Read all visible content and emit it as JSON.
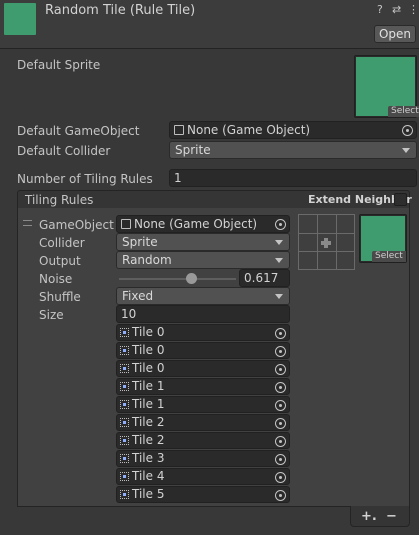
{
  "header": {
    "title": "Random Tile (Rule Tile)",
    "open_label": "Open",
    "help_icon": "?",
    "settings_icon": "⇄",
    "more_icon": "⋮"
  },
  "default_sprite": {
    "label": "Default Sprite",
    "select_label": "Select"
  },
  "default_gameobject": {
    "label": "Default GameObject",
    "value": "None (Game Object)"
  },
  "default_collider": {
    "label": "Default Collider",
    "value": "Sprite"
  },
  "num_rules": {
    "label": "Number of Tiling Rules",
    "value": "1"
  },
  "tiling_rules": {
    "title": "Tiling Rules",
    "extend_neighbor": "Extend Neighbor",
    "rule": {
      "gameobject_label": "GameObject",
      "gameobject_value": "None (Game Object)",
      "collider_label": "Collider",
      "collider_value": "Sprite",
      "output_label": "Output",
      "output_value": "Random",
      "noise_label": "Noise",
      "noise_value": "0.617",
      "noise_fraction": 0.617,
      "shuffle_label": "Shuffle",
      "shuffle_value": "Fixed",
      "size_label": "Size",
      "size_value": "10",
      "sprite_select": "Select",
      "tiles": [
        "Tile 0",
        "Tile 0",
        "Tile 0",
        "Tile 1",
        "Tile 1",
        "Tile 2",
        "Tile 2",
        "Tile 3",
        "Tile 4",
        "Tile 5"
      ]
    },
    "add_label": "+.",
    "remove_label": "−"
  },
  "colors": {
    "sprite_green": "#3e9c6f",
    "background": "#383838"
  }
}
